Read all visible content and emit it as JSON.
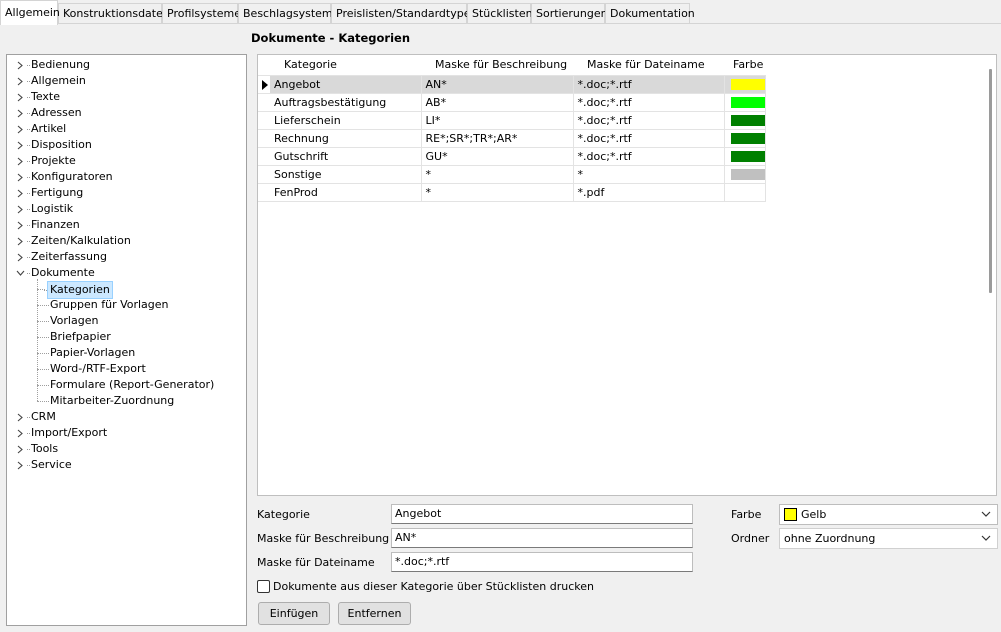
{
  "tabs": [
    "Allgemein",
    "Konstruktionsdaten",
    "Profilsysteme",
    "Beschlagsysteme",
    "Preislisten/Standardtypen",
    "Stücklisten",
    "Sortierungen",
    "Dokumentation"
  ],
  "tree": {
    "top_items_before": [
      "Bedienung",
      "Allgemein",
      "Texte",
      "Adressen",
      "Artikel",
      "Disposition",
      "Projekte",
      "Konfiguratoren",
      "Fertigung",
      "Logistik",
      "Finanzen",
      "Zeiten/Kalkulation",
      "Zeiterfassung"
    ],
    "expanded": "Dokumente",
    "children": [
      "Kategorien",
      "Gruppen für Vorlagen",
      "Vorlagen",
      "Briefpapier",
      "Papier-Vorlagen",
      "Word-/RTF-Export",
      "Formulare (Report-Generator)",
      "Mitarbeiter-Zuordnung"
    ],
    "top_items_after": [
      "CRM",
      "Import/Export",
      "Tools",
      "Service"
    ]
  },
  "section_title": "Dokumente - Kategorien",
  "grid": {
    "columns": [
      "Kategorie",
      "Maske für Beschreibung",
      "Maske für Dateiname",
      "Farbe"
    ],
    "rows": [
      {
        "kategorie": "Angebot",
        "beschreibung": "AN*",
        "dateiname": "*.doc;*.rtf",
        "color": "#ffff00"
      },
      {
        "kategorie": "Auftragsbestätigung",
        "beschreibung": "AB*",
        "dateiname": "*.doc;*.rtf",
        "color": "#00ff00"
      },
      {
        "kategorie": "Lieferschein",
        "beschreibung": "LI*",
        "dateiname": "*.doc;*.rtf",
        "color": "#008000"
      },
      {
        "kategorie": "Rechnung",
        "beschreibung": "RE*;SR*;TR*;AR*",
        "dateiname": "*.doc;*.rtf",
        "color": "#008000"
      },
      {
        "kategorie": "Gutschrift",
        "beschreibung": "GU*",
        "dateiname": "*.doc;*.rtf",
        "color": "#008000"
      },
      {
        "kategorie": "Sonstige",
        "beschreibung": "*",
        "dateiname": "*",
        "color": "#c0c0c0"
      },
      {
        "kategorie": "FenProd",
        "beschreibung": "*",
        "dateiname": "*.pdf",
        "color": ""
      }
    ]
  },
  "form": {
    "kategorie_label": "Kategorie",
    "kategorie_value": "Angebot",
    "beschreibung_label": "Maske für Beschreibung",
    "beschreibung_value": "AN*",
    "dateiname_label": "Maske für Dateiname",
    "dateiname_value": "*.doc;*.rtf",
    "farbe_label": "Farbe",
    "farbe_value": "Gelb",
    "farbe_color": "#ffff00",
    "ordner_label": "Ordner",
    "ordner_value": "ohne Zuordnung",
    "checkbox_label": "Dokumente aus dieser Kategorie über Stücklisten drucken",
    "checkbox_checked": false
  },
  "buttons": {
    "insert": "Einfügen",
    "remove": "Entfernen"
  }
}
